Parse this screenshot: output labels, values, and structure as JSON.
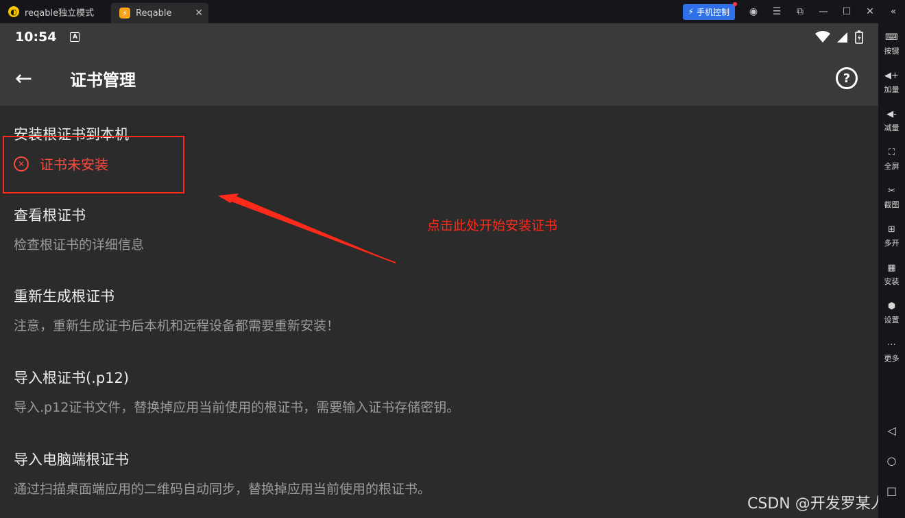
{
  "window": {
    "tab1_label": "reqable独立模式",
    "tab1_icon": "app-logo-icon",
    "tab2_label": "Reqable",
    "tab2_icon": "reqable-icon",
    "tab_close": "✕",
    "phone_control_label": "手机控制",
    "controls": [
      "user-icon",
      "menu-icon",
      "popout-icon",
      "minimize-icon",
      "maximize-icon",
      "close-icon",
      "collapse-icon"
    ]
  },
  "statusbar": {
    "time": "10:54",
    "notif_glyph": "A"
  },
  "appbar": {
    "title": "证书管理",
    "back_glyph": "←",
    "help_glyph": "?"
  },
  "items": [
    {
      "title": "安装根证书到本机",
      "status": "证书未安装",
      "status_color": "#ff4a3d"
    },
    {
      "title": "查看根证书",
      "subtitle": "检查根证书的详细信息"
    },
    {
      "title": "重新生成根证书",
      "subtitle": "注意，重新生成证书后本机和远程设备都需要重新安装！"
    },
    {
      "title": "导入根证书(.p12)",
      "subtitle": "导入.p12证书文件，替换掉应用当前使用的根证书，需要输入证书存储密钥。"
    },
    {
      "title": "导入电脑端根证书",
      "subtitle": "通过扫描桌面端应用的二维码自动同步，替换掉应用当前使用的根证书。"
    }
  ],
  "annotation": {
    "text": "点击此处开始安装证书",
    "color": "#ff2a1a"
  },
  "watermark": "CSDN @开发罗某人",
  "sidebar": [
    {
      "label": "按键",
      "icon": "keyboard-icon",
      "glyph": "⌨"
    },
    {
      "label": "加量",
      "icon": "volume-up-icon",
      "glyph": "◀+"
    },
    {
      "label": "减量",
      "icon": "volume-down-icon",
      "glyph": "◀-"
    },
    {
      "label": "全屏",
      "icon": "fullscreen-icon",
      "glyph": "⛶"
    },
    {
      "label": "截图",
      "icon": "scissors-icon",
      "glyph": "✂"
    },
    {
      "label": "多开",
      "icon": "multi-instance-icon",
      "glyph": "⊞"
    },
    {
      "label": "安装",
      "icon": "apk-install-icon",
      "glyph": "▦"
    },
    {
      "label": "设置",
      "icon": "settings-icon",
      "glyph": "⬢"
    },
    {
      "label": "更多",
      "icon": "more-icon",
      "glyph": "⋯"
    }
  ],
  "nav": {
    "back_glyph": "◁",
    "home_glyph": "○",
    "recent_glyph": "□"
  }
}
